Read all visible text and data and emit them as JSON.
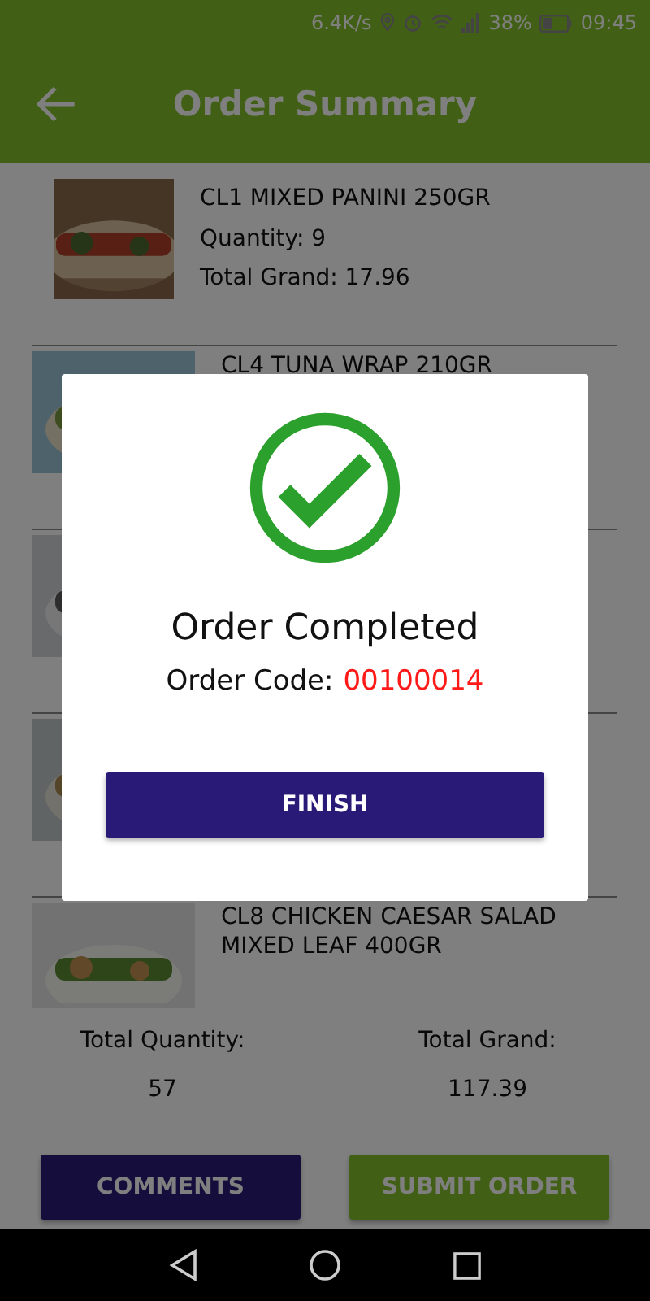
{
  "status_bar": {
    "speed": "6.4K/s",
    "battery": "38%",
    "time": "09:45"
  },
  "app_bar": {
    "title": "Order Summary"
  },
  "items": [
    {
      "kind": "product",
      "title": "CL1 MIXED PANINI 250GR",
      "quantity": "Quantity: 9",
      "total": "Total Grand: 17.96"
    },
    {
      "kind": "product",
      "title": "CL4 TUNA WRAP 210GR"
    },
    {
      "kind": "picture"
    },
    {
      "kind": "picture"
    },
    {
      "kind": "product",
      "title": "CL8 CHICKEN CAESAR SALAD MIXED LEAF 400GR"
    }
  ],
  "totals": [
    {
      "label": "Total Quantity:",
      "value": "57"
    },
    {
      "label": "Total Grand:",
      "value": "117.39"
    }
  ],
  "buttons": [
    {
      "label": "COMMENTS",
      "kind": "secondary"
    },
    {
      "label": "SUBMIT ORDER",
      "kind": "primary"
    }
  ],
  "dialog": {
    "title": "Order Completed",
    "code_label": "Order Code:",
    "code": "00100014",
    "button": "FINISH"
  }
}
